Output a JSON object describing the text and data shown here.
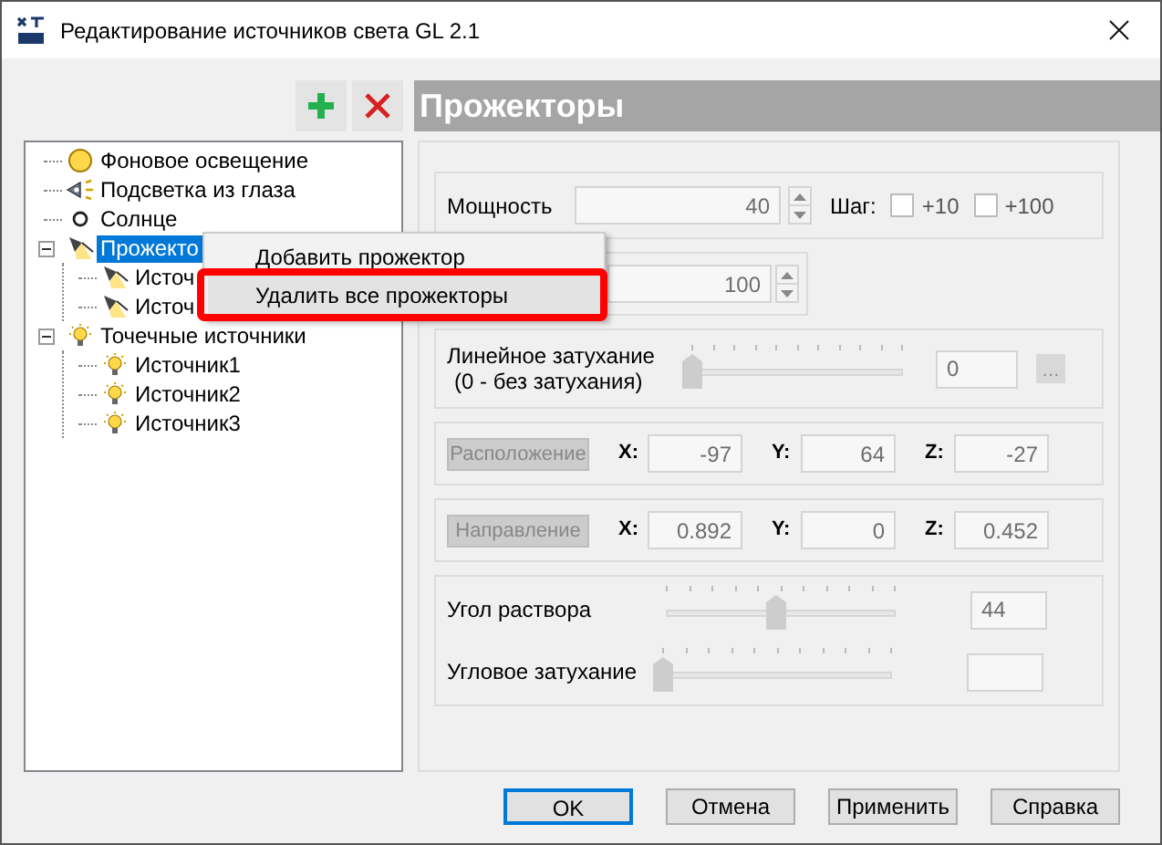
{
  "window": {
    "title": "Редактирование источников света GL 2.1"
  },
  "heading": "Прожекторы",
  "tree": [
    {
      "label": "Фоновое освещение",
      "kind": "ambient",
      "selected": false
    },
    {
      "label": "Подсветка из глаза",
      "kind": "eye",
      "selected": false
    },
    {
      "label": "Солнце",
      "kind": "sun",
      "selected": false
    },
    {
      "label": "Прожекто",
      "kind": "spot",
      "selected": true,
      "expanded": true,
      "children": [
        {
          "label": "Источ",
          "kind": "spot",
          "selected": false
        },
        {
          "label": "Источ",
          "kind": "spot",
          "selected": false
        }
      ]
    },
    {
      "label": "Точечные источники",
      "kind": "bulb",
      "selected": false,
      "expanded": true,
      "children": [
        {
          "label": "Источник1",
          "kind": "bulb",
          "selected": false
        },
        {
          "label": "Источник2",
          "kind": "bulb",
          "selected": false
        },
        {
          "label": "Источник3",
          "kind": "bulb",
          "selected": false
        }
      ]
    }
  ],
  "context_menu": [
    {
      "label": "Добавить прожектор",
      "selected": false,
      "highlighted": false
    },
    {
      "label": "Удалить все прожекторы",
      "selected": true,
      "highlighted": true
    }
  ],
  "power": {
    "label": "Мощность",
    "value": "40",
    "step_label": "Шаг:",
    "steps": [
      {
        "label": "+10",
        "checked": false
      },
      {
        "label": "+100",
        "checked": false
      }
    ]
  },
  "second": {
    "value": "100"
  },
  "linear": {
    "label_lines": [
      "Линейное затухание",
      "(0 - без затухания)"
    ],
    "level": 0,
    "value": "0",
    "button": "…"
  },
  "vectors": [
    {
      "button": "Расположение",
      "disabled": true,
      "coords": [
        {
          "axis": "X:",
          "value": "-97"
        },
        {
          "axis": "Y:",
          "value": "64"
        },
        {
          "axis": "Z:",
          "value": "-27"
        }
      ]
    },
    {
      "button": "Направление",
      "disabled": true,
      "coords": [
        {
          "axis": "X:",
          "value": "0.892"
        },
        {
          "axis": "Y:",
          "value": "0"
        },
        {
          "axis": "Z:",
          "value": "0.452"
        }
      ]
    }
  ],
  "cone": [
    {
      "label": "Угол раствора",
      "level": 0.48,
      "value": "44"
    },
    {
      "label": "Угловое затухание",
      "level": 0
    }
  ],
  "buttons": [
    {
      "label": "OK",
      "default": true
    },
    {
      "label": "Отмена",
      "default": false
    },
    {
      "label": "Применить",
      "default": false
    },
    {
      "label": "Справка",
      "default": false
    }
  ]
}
